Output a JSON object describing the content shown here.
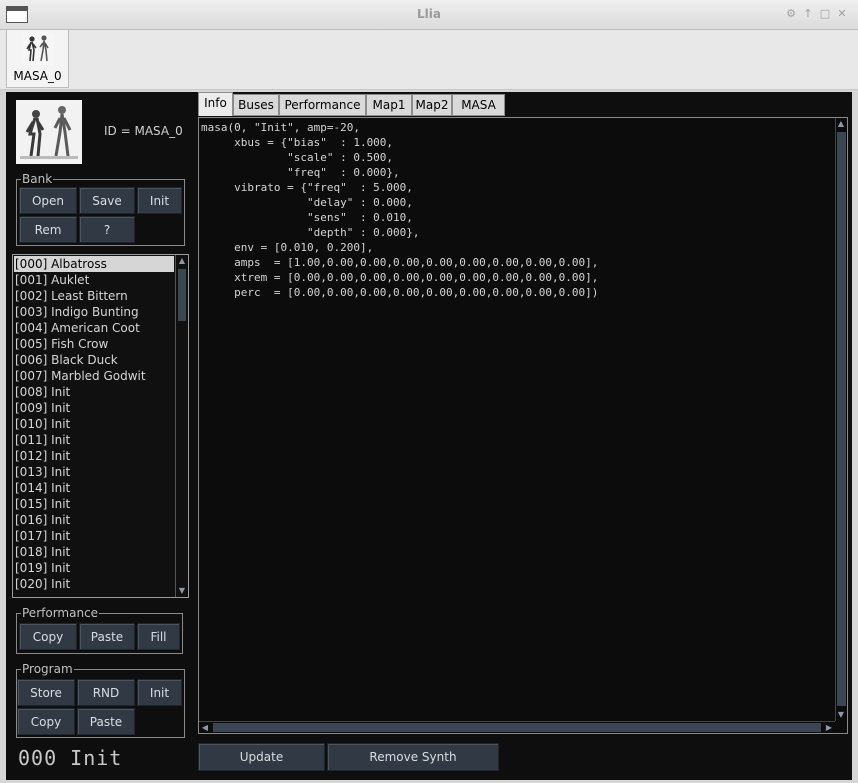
{
  "window": {
    "title": "Llia",
    "icons": [
      "gear-icon",
      "up-icon",
      "maximize-icon",
      "close-icon"
    ]
  },
  "synth_tab": {
    "label": "MASA_0"
  },
  "left": {
    "id_label": "ID = MASA_0",
    "bank": {
      "legend": "Bank",
      "buttons": [
        "Open",
        "Save",
        "Init",
        "Rem",
        "?"
      ]
    },
    "program_list": [
      "[000] Albatross",
      "[001] Auklet",
      "[002] Least Bittern",
      "[003] Indigo Bunting",
      "[004] American Coot",
      "[005] Fish Crow",
      "[006] Black Duck",
      "[007] Marbled Godwit",
      "[008] Init",
      "[009] Init",
      "[010] Init",
      "[011] Init",
      "[012] Init",
      "[013] Init",
      "[014] Init",
      "[015] Init",
      "[016] Init",
      "[017] Init",
      "[018] Init",
      "[019] Init",
      "[020] Init"
    ],
    "selected_index": 0,
    "performance": {
      "legend": "Performance",
      "buttons": [
        "Copy",
        "Paste",
        "Fill"
      ]
    },
    "program": {
      "legend": "Program",
      "buttons": [
        "Store",
        "RND",
        "Init",
        "Copy",
        "Paste"
      ]
    },
    "status": "000 Init"
  },
  "tabs": [
    "Info",
    "Buses",
    "Performance",
    "Map1",
    "Map2",
    "MASA"
  ],
  "active_tab": "Info",
  "info_text": "masa(0, \"Init\", amp=-20,\n     xbus = {\"bias\"  : 1.000,\n             \"scale\" : 0.500,\n             \"freq\"  : 0.000},\n     vibrato = {\"freq\"  : 5.000,\n                \"delay\" : 0.000,\n                \"sens\"  : 0.010,\n                \"depth\" : 0.000},\n     env = [0.010, 0.200],\n     amps  = [1.00,0.00,0.00,0.00,0.00,0.00,0.00,0.00,0.00],\n     xtrem = [0.00,0.00,0.00,0.00,0.00,0.00,0.00,0.00,0.00],\n     perc  = [0.00,0.00,0.00,0.00,0.00,0.00,0.00,0.00,0.00])",
  "bottom_buttons": {
    "update": "Update",
    "remove": "Remove Synth"
  }
}
